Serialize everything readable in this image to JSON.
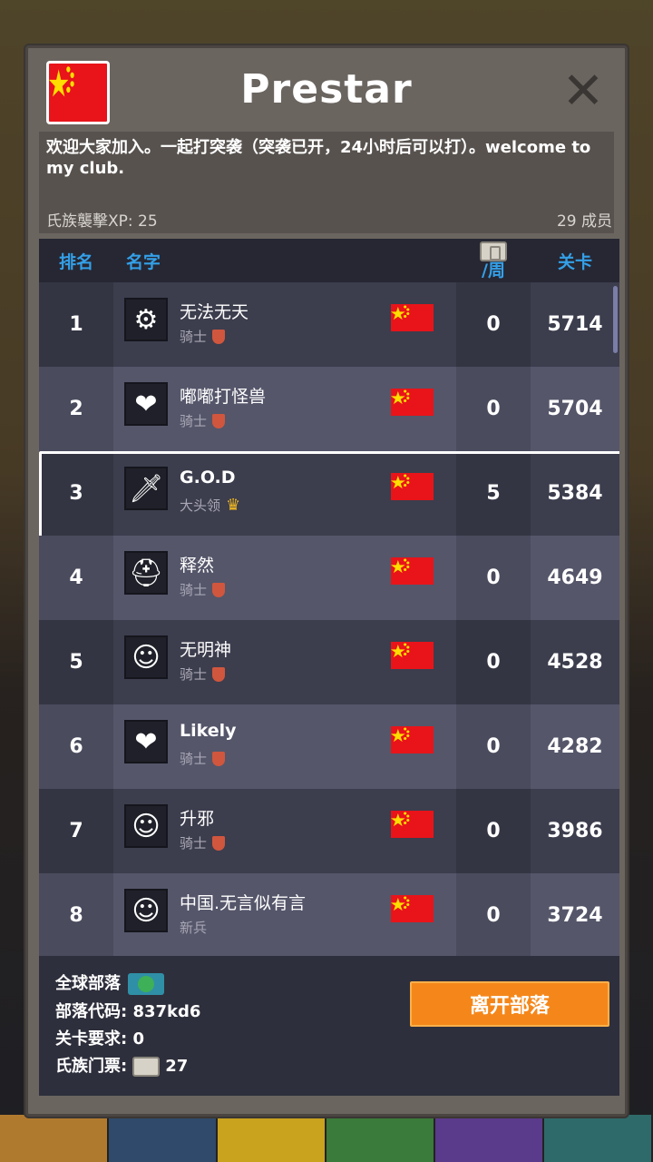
{
  "club": {
    "name": "Prestar",
    "description": "欢迎大家加入。一起打突袭（突袭已开，24小时后可以打）。welcome to my club.",
    "xp_label": "氏族襲擊XP: 25",
    "members_label": "29 成员"
  },
  "table": {
    "headers": {
      "rank": "排名",
      "name": "名字",
      "week": "/周",
      "level": "关卡"
    },
    "rows": [
      {
        "rank": "1",
        "name": "无法无天",
        "role": "骑士",
        "week": "0",
        "level": "5714",
        "avatar": "gear-box-icon",
        "role_icon": "shield-icon"
      },
      {
        "rank": "2",
        "name": "嘟嘟打怪兽",
        "role": "骑士",
        "week": "0",
        "level": "5704",
        "avatar": "winged-heart-icon",
        "role_icon": "shield-icon"
      },
      {
        "rank": "3",
        "name": "G.O.D",
        "role": "大头领",
        "week": "5",
        "level": "5384",
        "avatar": "sword-icon",
        "role_icon": "crown-icon"
      },
      {
        "rank": "4",
        "name": "释然",
        "role": "骑士",
        "week": "0",
        "level": "4649",
        "avatar": "horned-helmet-icon",
        "role_icon": "shield-icon"
      },
      {
        "rank": "5",
        "name": "无明神",
        "role": "骑士",
        "week": "0",
        "level": "4528",
        "avatar": "hooded-face-icon",
        "role_icon": "shield-icon"
      },
      {
        "rank": "6",
        "name": "Likely",
        "role": "骑士",
        "week": "0",
        "level": "4282",
        "avatar": "winged-heart-icon",
        "role_icon": "shield-icon"
      },
      {
        "rank": "7",
        "name": "升邪",
        "role": "骑士",
        "week": "0",
        "level": "3986",
        "avatar": "hooded-face-icon",
        "role_icon": "shield-icon"
      },
      {
        "rank": "8",
        "name": "中国.无言似有言",
        "role": "新兵",
        "week": "0",
        "level": "3724",
        "avatar": "hooded-face-icon",
        "role_icon": ""
      }
    ]
  },
  "footer": {
    "global_label": "全球部落",
    "code_label": "部落代码: 837kd6",
    "requirement_label": "关卡要求: 0",
    "ticket_label": "氏族门票:",
    "ticket_value": "27",
    "leave_button": "离开部落"
  },
  "colors": {
    "accent_blue": "#34a0e8",
    "button_orange": "#f5871a",
    "flag_red": "#e8141a",
    "flag_star": "#ffde00"
  }
}
